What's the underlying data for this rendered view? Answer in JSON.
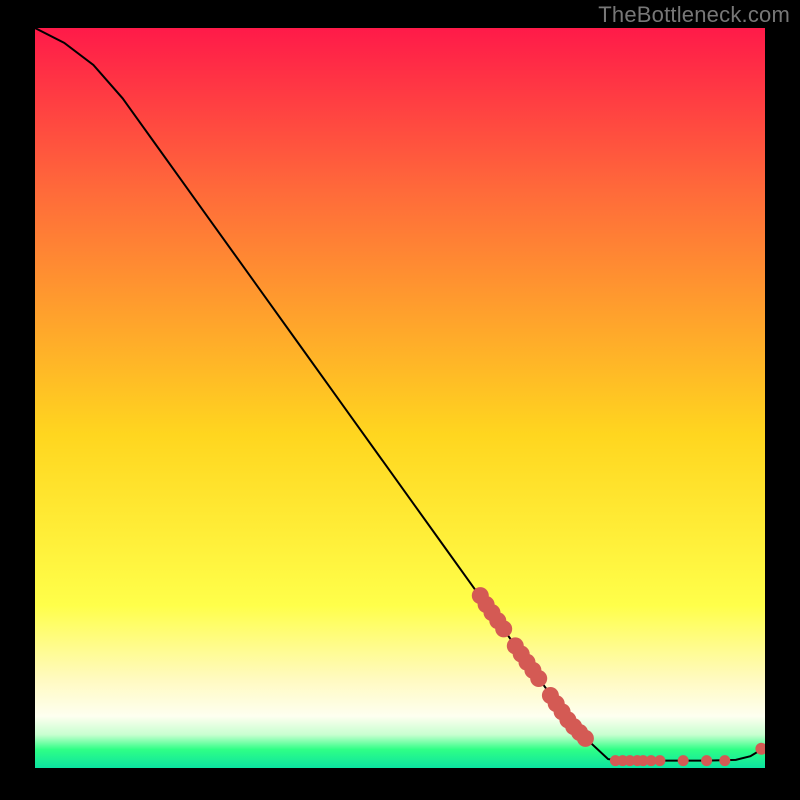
{
  "attribution": "TheBottleneck.com",
  "colors": {
    "bg": "#000000",
    "gradient_top": "#ff1a49",
    "gradient_upper": "#ff6a3a",
    "gradient_mid": "#ffd61f",
    "gradient_lower_yellow": "#ffff4a",
    "gradient_lower_cream": "#fffac0",
    "gradient_band_white": "#fefff0",
    "gradient_band_pale_green": "#c8ffd0",
    "gradient_band_green": "#2fff86",
    "gradient_band_teal": "#0be3a0",
    "line": "#000000",
    "marker_fill": "#d45a54",
    "marker_stroke": "#c34b46"
  },
  "chart_data": {
    "type": "line",
    "title": "",
    "xlabel": "",
    "ylabel": "",
    "xlim": [
      0,
      100
    ],
    "ylim": [
      0,
      100
    ],
    "curve": [
      {
        "x": 0,
        "y": 100
      },
      {
        "x": 4,
        "y": 98
      },
      {
        "x": 8,
        "y": 95
      },
      {
        "x": 12,
        "y": 90.5
      },
      {
        "x": 16,
        "y": 85
      },
      {
        "x": 20,
        "y": 79.5
      },
      {
        "x": 24,
        "y": 74
      },
      {
        "x": 28,
        "y": 68.5
      },
      {
        "x": 32,
        "y": 63
      },
      {
        "x": 36,
        "y": 57.5
      },
      {
        "x": 40,
        "y": 52
      },
      {
        "x": 44,
        "y": 46.5
      },
      {
        "x": 48,
        "y": 41
      },
      {
        "x": 52,
        "y": 35.5
      },
      {
        "x": 56,
        "y": 30
      },
      {
        "x": 60,
        "y": 24.5
      },
      {
        "x": 64,
        "y": 19
      },
      {
        "x": 68,
        "y": 13.5
      },
      {
        "x": 72,
        "y": 8
      },
      {
        "x": 76,
        "y": 3.5
      },
      {
        "x": 78.5,
        "y": 1.2
      },
      {
        "x": 80,
        "y": 1.0
      },
      {
        "x": 84,
        "y": 1.0
      },
      {
        "x": 88,
        "y": 1.0
      },
      {
        "x": 92,
        "y": 1.0
      },
      {
        "x": 96,
        "y": 1.1
      },
      {
        "x": 98,
        "y": 1.6
      },
      {
        "x": 100,
        "y": 2.8
      }
    ],
    "markers_thick": [
      {
        "x": 61.0,
        "y": 23.3
      },
      {
        "x": 61.8,
        "y": 22.1
      },
      {
        "x": 62.6,
        "y": 21.0
      },
      {
        "x": 63.4,
        "y": 19.9
      },
      {
        "x": 64.2,
        "y": 18.8
      },
      {
        "x": 65.8,
        "y": 16.5
      },
      {
        "x": 66.6,
        "y": 15.4
      },
      {
        "x": 67.4,
        "y": 14.3
      },
      {
        "x": 68.2,
        "y": 13.2
      },
      {
        "x": 69.0,
        "y": 12.1
      },
      {
        "x": 70.6,
        "y": 9.8
      },
      {
        "x": 71.4,
        "y": 8.7
      },
      {
        "x": 72.2,
        "y": 7.6
      },
      {
        "x": 73.0,
        "y": 6.5
      },
      {
        "x": 73.8,
        "y": 5.6
      },
      {
        "x": 74.6,
        "y": 4.8
      },
      {
        "x": 75.4,
        "y": 4.0
      }
    ],
    "markers_bottom": [
      {
        "x": 79.5,
        "y": 1.0
      },
      {
        "x": 80.5,
        "y": 1.0
      },
      {
        "x": 81.5,
        "y": 1.0
      },
      {
        "x": 82.5,
        "y": 1.0
      },
      {
        "x": 83.3,
        "y": 1.0
      },
      {
        "x": 84.4,
        "y": 1.0
      },
      {
        "x": 85.6,
        "y": 1.0
      },
      {
        "x": 88.8,
        "y": 1.0
      },
      {
        "x": 92.0,
        "y": 1.0
      },
      {
        "x": 94.5,
        "y": 1.0
      }
    ],
    "marker_tail": {
      "x": 99.5,
      "y": 2.6
    }
  }
}
